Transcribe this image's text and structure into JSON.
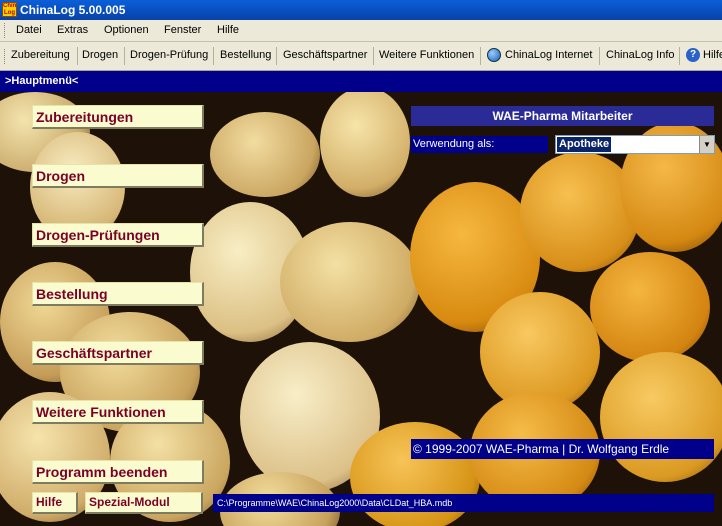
{
  "window": {
    "title": "ChinaLog 5.00.005",
    "app_icon_text": "China Log"
  },
  "menubar": {
    "items": [
      "Datei",
      "Extras",
      "Optionen",
      "Fenster",
      "Hilfe"
    ]
  },
  "toolbar": {
    "items": [
      "Zubereitung",
      "Drogen",
      "Drogen-Prüfung",
      "Bestellung",
      "Geschäftspartner",
      "Weitere Funktionen",
      "ChinaLog Internet",
      "ChinaLog Info",
      "Hilfe"
    ]
  },
  "form": {
    "header": ">Hauptmenü<"
  },
  "main_menu": {
    "buttons": [
      "Zubereitungen",
      "Drogen",
      "Drogen-Prüfungen",
      "Bestellung",
      "Geschäftspartner",
      "Weitere Funktionen",
      "Programm beenden"
    ]
  },
  "bottom_buttons": {
    "help": "Hilfe",
    "special": "Spezial-Modul"
  },
  "staff": {
    "title": "WAE-Pharma Mitarbeiter",
    "use_label": "Verwendung als:",
    "use_value": "Apotheke"
  },
  "footer": {
    "copyright": "© 1999-2007 WAE-Pharma | Dr. Wolfgang Erdle",
    "db_path": "C:\\Programme\\WAE\\ChinaLog2000\\Data\\CLDat_HBA.mdb"
  },
  "colors": {
    "title_bar": "#0842a8",
    "form_header": "#00008b",
    "button_face": "#fbfbd0",
    "button_text": "#7a0026"
  },
  "icons": {
    "internet": "globe-icon",
    "help": "help-icon"
  }
}
